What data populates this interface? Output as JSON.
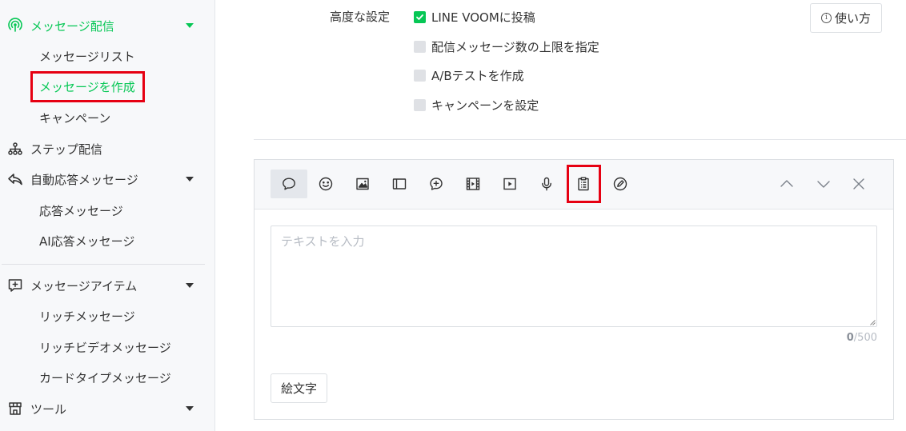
{
  "colors": {
    "accent": "#06c755",
    "highlight": "#e60012",
    "text": "#333333",
    "muted": "#b7bcc4"
  },
  "sidebar": {
    "broadcast": {
      "label": "メッセージ配信",
      "icon": "broadcast-icon",
      "items": [
        {
          "label": "メッセージリスト"
        },
        {
          "label": "メッセージを作成",
          "current": true
        },
        {
          "label": "キャンペーン"
        }
      ]
    },
    "step": {
      "label": "ステップ配信",
      "icon": "flow-tree-icon"
    },
    "auto_reply": {
      "label": "自動応答メッセージ",
      "icon": "reply-arrow-icon",
      "items": [
        {
          "label": "応答メッセージ"
        },
        {
          "label": "AI応答メッセージ"
        }
      ]
    },
    "message_items": {
      "label": "メッセージアイテム",
      "icon": "add-box-icon",
      "items": [
        {
          "label": "リッチメッセージ"
        },
        {
          "label": "リッチビデオメッセージ"
        },
        {
          "label": "カードタイプメッセージ"
        }
      ]
    },
    "tools": {
      "label": "ツール",
      "icon": "store-icon"
    }
  },
  "advanced": {
    "label": "高度な設定",
    "options": [
      {
        "label": "LINE VOOMに投稿",
        "checked": true
      },
      {
        "label": "配信メッセージ数の上限を指定",
        "checked": false
      },
      {
        "label": "A/Bテストを作成",
        "checked": false
      },
      {
        "label": "キャンペーンを設定",
        "checked": false
      }
    ],
    "help_label": "使い方",
    "help_icon_glyph": "i"
  },
  "editor": {
    "toolbar": [
      {
        "icon": "text-bubble-icon",
        "selected": true
      },
      {
        "icon": "sticker-smile-icon"
      },
      {
        "icon": "image-icon"
      },
      {
        "icon": "card-message-icon"
      },
      {
        "icon": "rich-message-icon"
      },
      {
        "icon": "video-icon"
      },
      {
        "icon": "rich-video-icon"
      },
      {
        "icon": "voice-mic-icon"
      },
      {
        "icon": "survey-clipboard-icon",
        "highlighted": true
      },
      {
        "icon": "coupon-pen-icon"
      }
    ],
    "controls": [
      "move-up-icon",
      "move-down-icon",
      "close-icon"
    ],
    "text_placeholder": "テキストを入力",
    "char_count": "0",
    "char_limit": "/500",
    "emoji_button": "絵文字"
  }
}
